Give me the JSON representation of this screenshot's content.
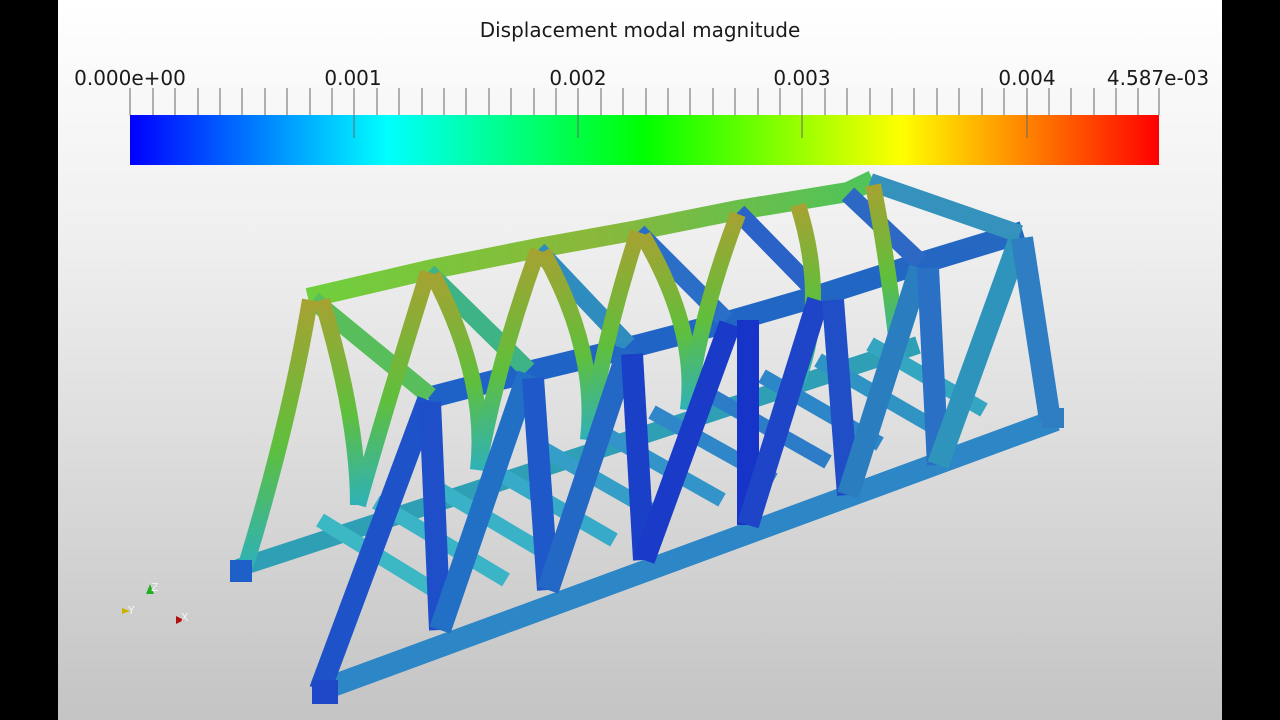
{
  "scalar_bar": {
    "title": "Displacement modal magnitude",
    "ticks": [
      {
        "label": "0.000e+00",
        "value": 0.0
      },
      {
        "label": "0.001",
        "value": 0.001
      },
      {
        "label": "0.002",
        "value": 0.002
      },
      {
        "label": "0.003",
        "value": 0.003
      },
      {
        "label": "0.004",
        "value": 0.004
      },
      {
        "label": "4.587e-03",
        "value": 0.004587
      }
    ],
    "range": [
      0.0,
      0.004587
    ],
    "colormap": [
      "#0000ff",
      "#00ffff",
      "#00ff00",
      "#ffff00",
      "#ff0000"
    ]
  },
  "orientation_axes": {
    "z": {
      "label": "Z",
      "color": "#22b022"
    },
    "y": {
      "label": "Y",
      "color": "#c8b400"
    },
    "x": {
      "label": "X",
      "color": "#b01010"
    }
  },
  "model": {
    "colors": {
      "deep_blue": "#1535c8",
      "blue": "#1f55c8",
      "cyan": "#3db8c6",
      "teal": "#2f9fb0",
      "green": "#5cc23a",
      "olive": "#98a82c"
    }
  }
}
